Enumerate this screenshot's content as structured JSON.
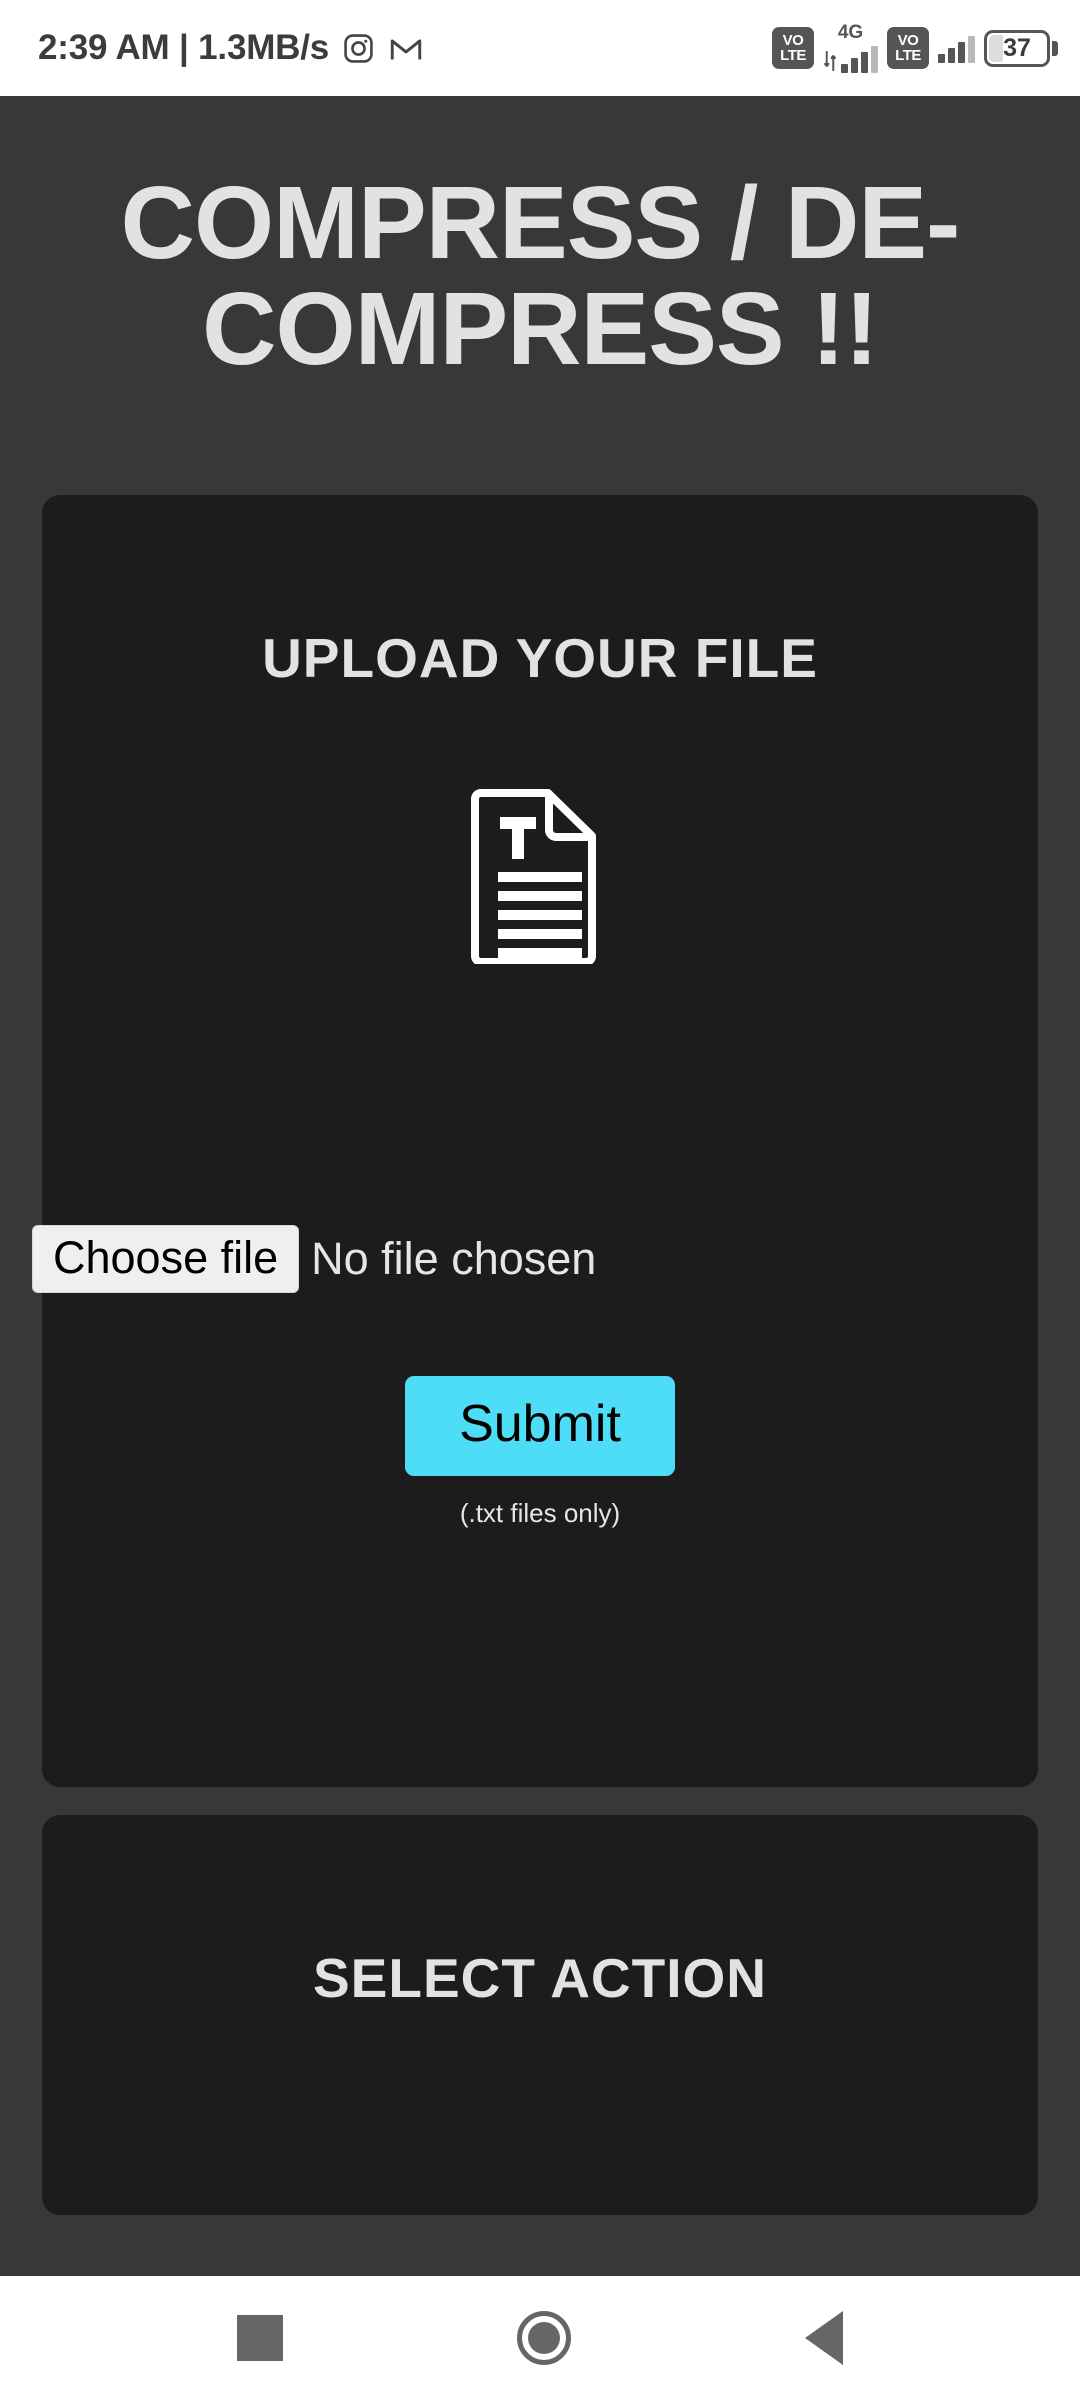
{
  "statusbar": {
    "clock": "2:39 AM | 1.3MB/s",
    "instagram_icon": "instagram-icon",
    "gmail_icon": "gmail-icon",
    "volte1": {
      "line1": "VO",
      "line2": "LTE"
    },
    "network_label": "4G",
    "volte2": {
      "line1": "VO",
      "line2": "LTE"
    },
    "battery_percent": "37"
  },
  "page": {
    "title": "COMPRESS / DE-COMPRESS !!",
    "background_color": "#383838",
    "card_color": "#1c1c1c",
    "accent_color": "#4DDDF7"
  },
  "upload_card": {
    "heading": "UPLOAD YOUR FILE",
    "file_icon": "text-document-icon",
    "choose_file_label": "Choose file",
    "no_file_text": "No file chosen",
    "submit_label": "Submit",
    "hint": "(.txt files only)"
  },
  "action_card": {
    "heading": "SELECT  ACTION"
  },
  "navbar": {
    "recents": "recents-square-icon",
    "home": "home-circle-icon",
    "back": "back-triangle-icon"
  }
}
